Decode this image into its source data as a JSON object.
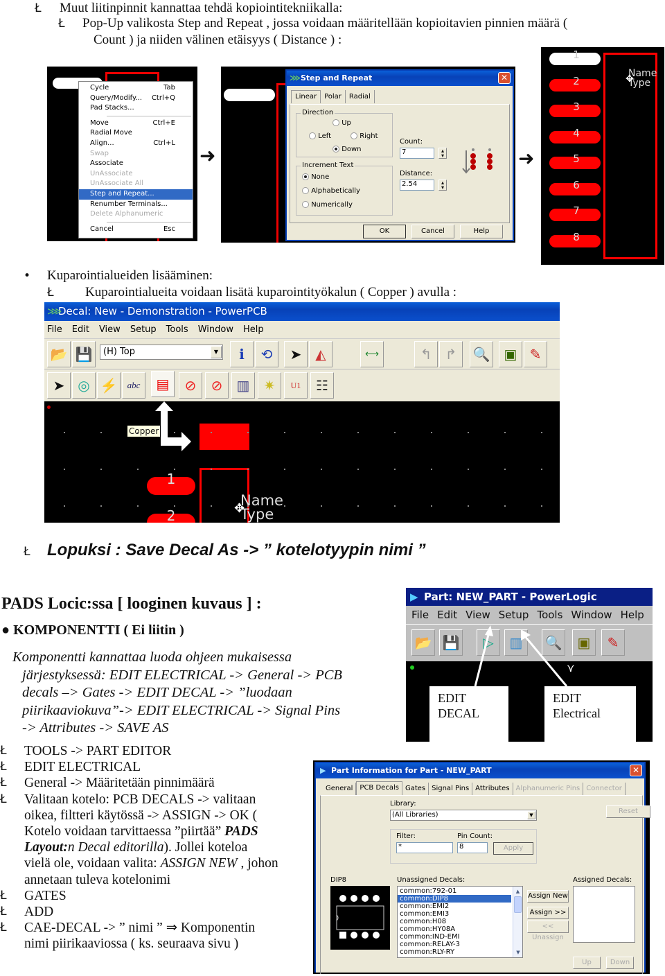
{
  "section1": {
    "bullet": "Ł",
    "line1": "Muut liitinpinnit kannattaa tehdä kopiointitekniikalla:",
    "line2": "Pop-Up valikosta Step and Repeat , jossa voidaan määritellään kopioitavien pinnien määrä (",
    "line3": "Count ) ja niiden välinen etäisyys ( Distance ) :"
  },
  "context_menu": {
    "items": [
      {
        "label": "Cycle",
        "shortcut": "Tab",
        "disabled": false
      },
      {
        "label": "Query/Modify...",
        "shortcut": "Ctrl+Q",
        "disabled": false
      },
      {
        "label": "Pad Stacks...",
        "shortcut": "",
        "disabled": false
      },
      {
        "separator": true
      },
      {
        "label": "Move",
        "shortcut": "Ctrl+E",
        "disabled": false
      },
      {
        "label": "Radial Move",
        "shortcut": "",
        "disabled": false
      },
      {
        "label": "Align...",
        "shortcut": "Ctrl+L",
        "disabled": false
      },
      {
        "label": "Swap",
        "shortcut": "",
        "disabled": true
      },
      {
        "label": "Associate",
        "shortcut": "",
        "disabled": false
      },
      {
        "label": "UnAssociate",
        "shortcut": "",
        "disabled": true
      },
      {
        "label": "UnAssociate All",
        "shortcut": "",
        "disabled": true
      },
      {
        "label": "Step and Repeat...",
        "shortcut": "",
        "disabled": false,
        "selected": true
      },
      {
        "label": "Renumber Terminals...",
        "shortcut": "",
        "disabled": false
      },
      {
        "label": "Delete Alphanumeric",
        "shortcut": "",
        "disabled": true
      },
      {
        "separator": true
      },
      {
        "label": "Cancel",
        "shortcut": "Esc",
        "disabled": false
      }
    ]
  },
  "step_repeat": {
    "title": "Step and Repeat",
    "tabs": [
      "Linear",
      "Polar",
      "Radial"
    ],
    "direction_label": "Direction",
    "dir_up": "Up",
    "dir_left": "Left",
    "dir_right": "Right",
    "dir_down": "Down",
    "direction_selected": "Down",
    "increment_label": "Increment Text",
    "inc_none": "None",
    "inc_alpha": "Alphabetically",
    "inc_num": "Numerically",
    "increment_selected": "None",
    "count_label": "Count:",
    "count_value": "7",
    "distance_label": "Distance:",
    "distance_value": "2.54",
    "ok": "OK",
    "cancel": "Cancel",
    "help": "Help"
  },
  "result_pins": [
    "1",
    "2",
    "3",
    "4",
    "5",
    "6",
    "7",
    "8"
  ],
  "ref_label": {
    "name": "Name",
    "type": "Type"
  },
  "section2": {
    "bullet": "•",
    "sub_bullet": "Ł",
    "heading": "Kuparointialueiden lisääminen:",
    "subline": "Kuparointialueita voidaan lisätä kuparointityökalun ( Copper ) avulla :"
  },
  "powerpcb": {
    "title": "Decal: New - Demonstration - PowerPCB",
    "menu": [
      "File",
      "Edit",
      "View",
      "Setup",
      "Tools",
      "Window",
      "Help"
    ],
    "layer_select": "(H) Top",
    "toolbar1_icons": [
      "open-icon",
      "save-icon",
      "info-icon",
      "refresh-icon",
      "select-icon",
      "drafting-icon",
      "dimension-icon",
      "undo-icon",
      "redo-icon",
      "zoom-icon",
      "board-icon",
      "paint-icon"
    ],
    "toolbar2_icons": [
      "select-arrow-icon",
      "terminal-icon",
      "2d-line-icon",
      "text-icon",
      "copper-icon",
      "copper-cutout-icon",
      "keepout-icon",
      "bus-icon",
      "wizard-icon",
      "decal-icon",
      "attributes-icon"
    ],
    "tooltip": "Copper",
    "pins": [
      "1",
      "2"
    ]
  },
  "section3": {
    "bullet": "Ł",
    "text": "Lopuksi : Save Decal As -> ” kotelotyypin nimi ”"
  },
  "section4": {
    "heading": "PADS Locic:ssa [ looginen kuvaus ] :",
    "sub_heading": "● KOMPONENTTI ( Ei liitin )",
    "para_lines": [
      "Komponentti kannattaa luoda ohjeen mukaisessa",
      "järjestyksessä: EDIT ELECTRICAL -> General -> PCB",
      "decals –> Gates -> EDIT DECAL -> ”luodaan",
      "piirikaaviokuva”-> EDIT ELECTRICAL -> Signal Pins",
      "-> Attributes -> SAVE AS"
    ]
  },
  "powerlogic": {
    "title": "Part: NEW_PART - PowerLogic",
    "menu": [
      "File",
      "Edit",
      "View",
      "Setup",
      "Tools",
      "Window",
      "Help"
    ],
    "callout_decal": [
      "EDIT",
      "DECAL"
    ],
    "callout_electrical": [
      "EDIT",
      "Electrical"
    ]
  },
  "steps": {
    "bullet": "Ł",
    "items": [
      [
        "TOOLS -> PART EDITOR"
      ],
      [
        "EDIT ELECTRICAL"
      ],
      [
        "General -> Määritetään pinnimäärä"
      ],
      [
        "Valitaan kotelo: PCB DECALS ->  valitaan",
        "oikea, filtteri käytössä  -> ASSIGN -> OK (",
        "Kotelo voidaan tarvittaessa ”piirtää” ",
        "PADS",
        "Layout:",
        "n Decal  editorilla",
        "). Jollei koteloa",
        "vielä ole, voidaan valita: ",
        "ASSIGN NEW",
        " , johon",
        "annetaan tuleva kotelonimi"
      ],
      [
        "GATES"
      ],
      [
        "ADD"
      ],
      [
        "CAE-DECAL -> ” nimi ”  ⇒ Komponentin",
        "nimi piirikaaviossa ( ks. seuraava sivu )"
      ]
    ]
  },
  "part_info": {
    "title": "Part Information for Part - NEW_PART",
    "tabs": [
      "General",
      "PCB Decals",
      "Gates",
      "Signal Pins",
      "Attributes",
      "Alphanumeric Pins",
      "Connector"
    ],
    "active_tab": "PCB Decals",
    "library_label": "Library:",
    "library_value": "(All Libraries)",
    "reset": "Reset",
    "filter_label": "Filter:",
    "filter_value": "*",
    "pin_count_label": "Pin Count:",
    "pin_count_value": "8",
    "apply": "Apply",
    "preview_label": "DIP8",
    "unassigned_label": "Unassigned Decals:",
    "unassigned": [
      "common:792-01",
      "common:DIP8",
      "common:EMI2",
      "common:EMI3",
      "common:H08",
      "common:HY08A",
      "common:IND-EMI",
      "common:RELAY-3",
      "common:RLY-RY"
    ],
    "selected_decal": "common:DIP8",
    "assign_new": "Assign New",
    "assign": "Assign >>",
    "unassign": "<< Unassign",
    "assigned_label": "Assigned Decals:",
    "up": "Up",
    "down": "Down"
  }
}
